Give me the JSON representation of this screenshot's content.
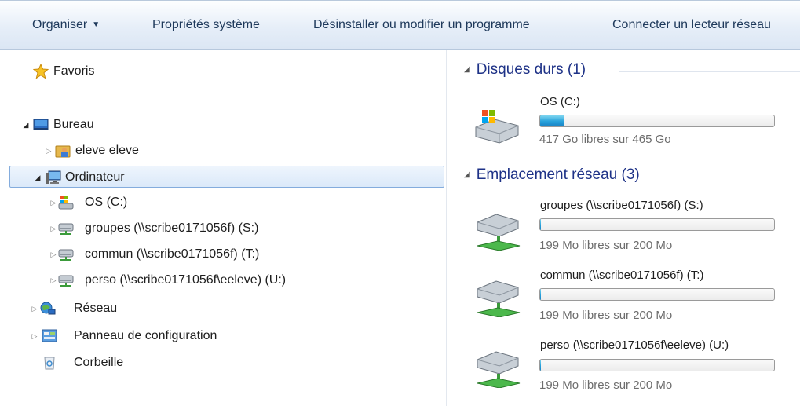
{
  "toolbar": {
    "organize": "Organiser",
    "system_properties": "Propriétés système",
    "uninstall": "Désinstaller ou modifier un programme",
    "map_drive": "Connecter un lecteur réseau"
  },
  "nav": {
    "favorites": "Favoris",
    "desktop": "Bureau",
    "user": "eleve eleve",
    "computer": "Ordinateur",
    "drive_c": "OS (C:)",
    "drive_s": "groupes (\\\\scribe0171056f) (S:)",
    "drive_t": "commun (\\\\scribe0171056f) (T:)",
    "drive_u": "perso (\\\\scribe0171056f\\eeleve) (U:)",
    "network": "Réseau",
    "control_panel": "Panneau de configuration",
    "recycle_bin": "Corbeille"
  },
  "content": {
    "hard_disks_header": "Disques durs (1)",
    "network_header": "Emplacement réseau (3)",
    "drives": [
      {
        "name": "OS (C:)",
        "free": "417 Go libres sur 465 Go",
        "used_fraction": 0.103
      },
      {
        "name": "groupes (\\\\scribe0171056f) (S:)",
        "free": "199 Mo libres sur 200 Mo",
        "used_fraction": 0.005
      },
      {
        "name": "commun (\\\\scribe0171056f) (T:)",
        "free": "199 Mo libres sur 200 Mo",
        "used_fraction": 0.005
      },
      {
        "name": "perso (\\\\scribe0171056f\\eeleve) (U:)",
        "free": "199 Mo libres sur 200 Mo",
        "used_fraction": 0.005
      }
    ]
  },
  "colors": {
    "usage_bar": "#26a0da",
    "group_header": "#1e3287",
    "toolbar_text": "#1e395b"
  },
  "icons": [
    "star-icon",
    "desktop-icon",
    "user-folder-icon",
    "computer-icon",
    "windows-drive-icon",
    "network-drive-icon",
    "network-icon",
    "control-panel-icon",
    "recycle-bin-icon"
  ]
}
